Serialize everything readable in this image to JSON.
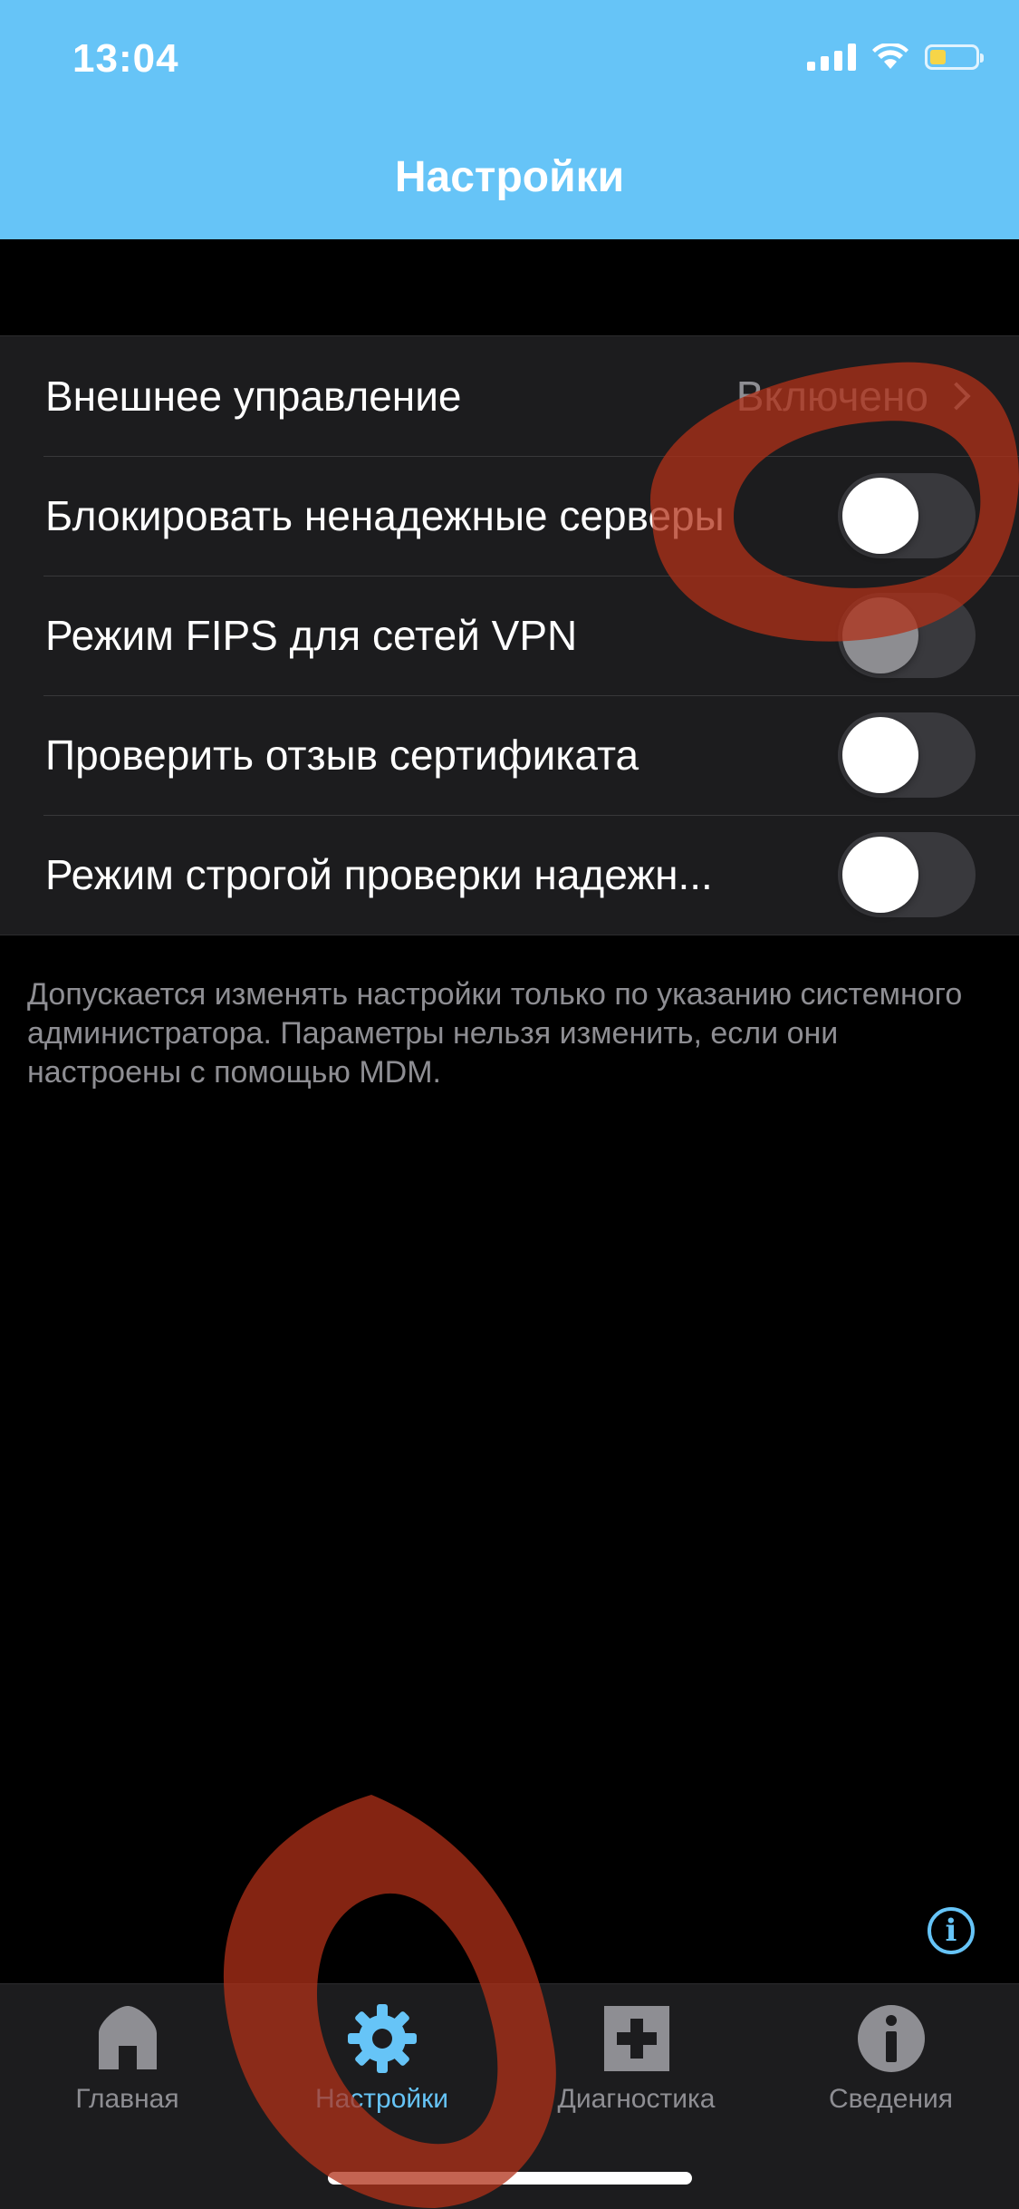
{
  "status_bar": {
    "time": "13:04",
    "battery_level": 0.35,
    "battery_color": "#f6d548",
    "icons": [
      "cellular-signal-icon",
      "wifi-icon",
      "battery-icon"
    ]
  },
  "nav": {
    "title": "Настройки",
    "background_color": "#66c4f7"
  },
  "settings": {
    "rows": [
      {
        "label": "Внешнее управление",
        "value": "Включено",
        "type": "disclosure"
      },
      {
        "label": "Блокировать ненадежные серверы",
        "type": "toggle",
        "on": false
      },
      {
        "label": "Режим FIPS для сетей VPN",
        "type": "toggle",
        "on": false
      },
      {
        "label": "Проверить отзыв сертификата",
        "type": "toggle",
        "on": false
      },
      {
        "label": "Режим строгой проверки надежн...",
        "type": "toggle",
        "on": false
      }
    ],
    "footnote": "Допускается изменять настройки только по указанию системного администратора. Параметры нельзя изменить, если они настроены с помощью MDM."
  },
  "info_button": {
    "icon": "info-icon",
    "glyph": "i"
  },
  "tabbar": {
    "tabs": [
      {
        "label": "Главная",
        "icon": "home-icon",
        "active": false
      },
      {
        "label": "Настройки",
        "icon": "gear-icon",
        "active": true
      },
      {
        "label": "Диагностика",
        "icon": "plus-box-icon",
        "active": false
      },
      {
        "label": "Сведения",
        "icon": "info-circle-icon",
        "active": false
      }
    ],
    "active_color": "#66c4f7",
    "inactive_color": "#8e8e93"
  },
  "annotations": {
    "color": "#b03018"
  }
}
